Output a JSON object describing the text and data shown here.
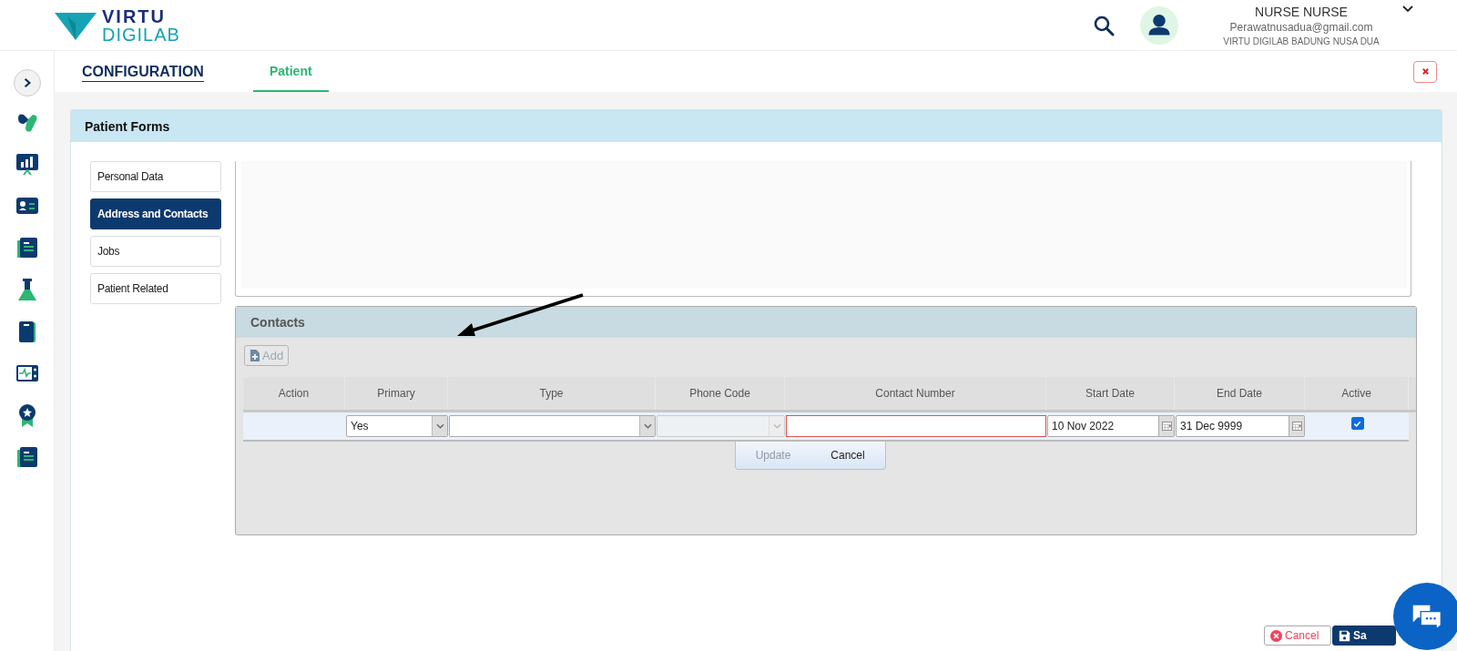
{
  "brand": {
    "line1": "VIRTU",
    "line2": "DIGILAB"
  },
  "user": {
    "name": "NURSE NURSE",
    "email": "Perawatnusadua@gmail.com",
    "org": "VIRTU DIGILAB BADUNG NUSA DUA"
  },
  "nav": {
    "title": "CONFIGURATION",
    "tabs": [
      {
        "label": "Patient",
        "selected": true
      }
    ]
  },
  "panel": {
    "title": "Patient Forms",
    "form_tabs": [
      {
        "label": "Personal Data",
        "selected": false
      },
      {
        "label": "Address and Contacts",
        "selected": true
      },
      {
        "label": "Jobs",
        "selected": false
      },
      {
        "label": "Patient Related",
        "selected": false
      }
    ]
  },
  "contacts": {
    "title": "Contacts",
    "add_button": {
      "label": "Add",
      "disabled": true
    },
    "columns": [
      "Action",
      "Primary",
      "Type",
      "Phone Code",
      "Contact Number",
      "Start Date",
      "End Date",
      "Active"
    ],
    "row": [
      {
        "kind": "empty"
      },
      {
        "kind": "select",
        "value": "Yes",
        "disabled": false
      },
      {
        "kind": "select",
        "disabled": false
      },
      {
        "kind": "select",
        "disabled": true
      },
      {
        "kind": "input",
        "invalid": true
      },
      {
        "kind": "date",
        "value": "10 Nov 2022"
      },
      {
        "kind": "date",
        "value": "31 Dec 9999"
      },
      {
        "kind": "checkbox",
        "checked": true
      }
    ],
    "row_buttons": [
      {
        "label": "Update",
        "disabled": true
      },
      {
        "label": "Cancel",
        "disabled": false
      }
    ]
  },
  "footer_buttons": [
    {
      "kind": "cancel",
      "label": "Cancel"
    },
    {
      "kind": "save",
      "label": "Sa"
    }
  ]
}
